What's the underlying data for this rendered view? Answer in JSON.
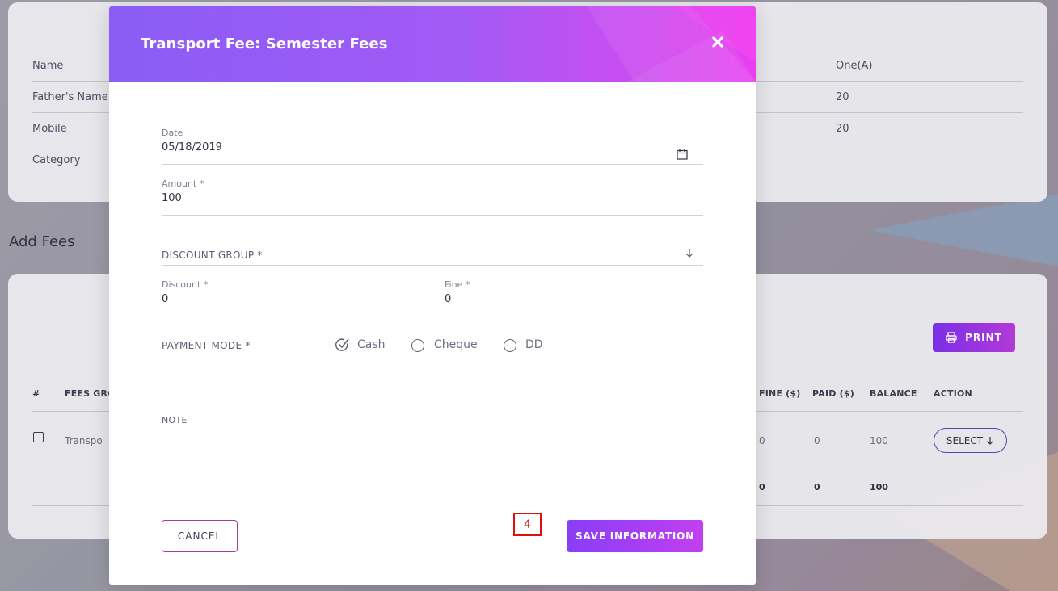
{
  "background": {
    "info_card": {
      "rows": [
        {
          "label": "Name",
          "right_value": "One(A)"
        },
        {
          "label": "Father's Name",
          "right_value": "20"
        },
        {
          "label": "Mobile",
          "right_value": "20"
        },
        {
          "label": "Category",
          "right_value": ""
        }
      ]
    },
    "section_title": "Add Fees",
    "print_button": "PRINT",
    "table": {
      "headers": {
        "hash": "#",
        "fees_group": "FEES GRO",
        "fine": "FINE ($)",
        "paid": "PAID ($)",
        "balance": "BALANCE",
        "action": "ACTION"
      },
      "row": {
        "fees_group": "Transpo",
        "fine": "0",
        "paid": "0",
        "balance": "100",
        "action": "SELECT"
      },
      "totals": {
        "fine": "0",
        "paid": "0",
        "balance": "100"
      }
    }
  },
  "modal": {
    "title": "Transport Fee: Semester Fees",
    "date": {
      "label": "Date",
      "value": "05/18/2019"
    },
    "amount": {
      "label": "Amount *",
      "value": "100"
    },
    "discount_group": {
      "label": "DISCOUNT GROUP *"
    },
    "discount": {
      "label": "Discount *",
      "value": "0"
    },
    "fine": {
      "label": "Fine *",
      "value": "0"
    },
    "payment_mode": {
      "label": "PAYMENT MODE *",
      "options": [
        "Cash",
        "Cheque",
        "DD"
      ],
      "selected": "Cash"
    },
    "note": {
      "label": "NOTE",
      "value": ""
    },
    "cancel_label": "CANCEL",
    "save_label": "SAVE INFORMATION",
    "marker": "4"
  },
  "colors": {
    "accent": "#8b5cf6",
    "accent_end": "#e83ef0",
    "danger_marker": "#e01010"
  }
}
